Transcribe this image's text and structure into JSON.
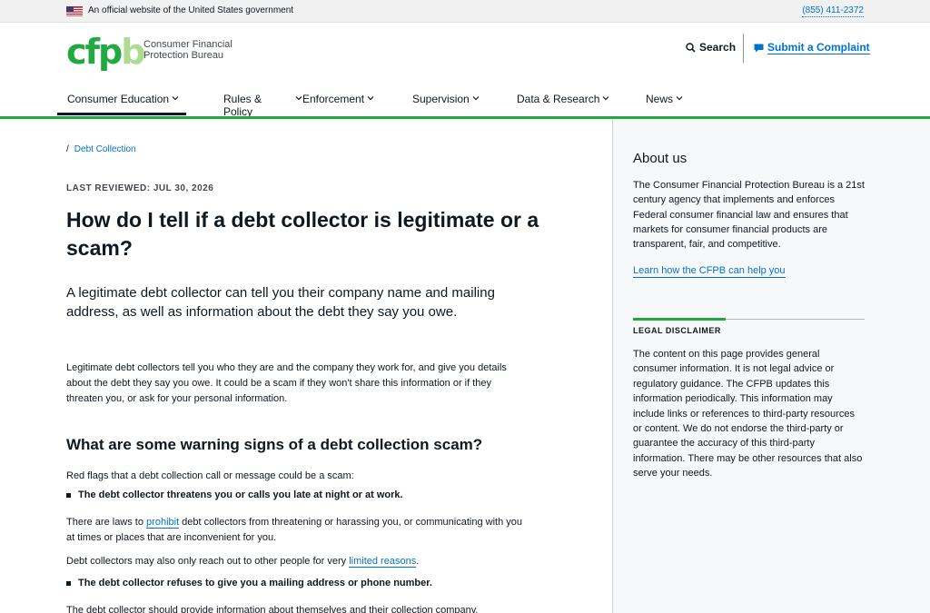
{
  "banner": {
    "text": "An official website of the United States government",
    "phone": "(855) 411-2372"
  },
  "header": {
    "logo_mark": "cfpb",
    "logo_line1": "Consumer Financial",
    "logo_line2": "Protection Bureau",
    "search_label": "Search",
    "complaint_label": "Submit a Complaint"
  },
  "nav": {
    "items": [
      {
        "label": "Consumer Education"
      },
      {
        "label": "Rules & Policy"
      },
      {
        "label": "Enforcement"
      },
      {
        "label": "Supervision"
      },
      {
        "label": "Data & Research"
      },
      {
        "label": "News"
      }
    ]
  },
  "breadcrumb": {
    "sep": "/",
    "item": "Debt Collection"
  },
  "article": {
    "reviewed": "LAST REVIEWED: JUL 30, 2026",
    "title": "How do I tell if a debt collector is legitimate or a scam?",
    "lead": "A legitimate debt collector can tell you their company name and mailing address, as well as information about the debt they say you owe.",
    "para1": "Legitimate debt collectors tell you who they are and the company they work for, and give you details about the debt they say you owe. It could be a scam if they won't share this information or if they threaten you, or ask for your personal information.",
    "h2": "What are some warning signs of a debt collection scam?",
    "red_flags": "Red flags that a debt collection call or message could be a scam:",
    "bullet1": "The debt collector threatens you or calls you late at night or at work.",
    "para2_pre": "There are laws to ",
    "para2_link": "prohibit",
    "para2_post": " debt collectors from threatening or harassing you, or communicating with you at times or places that are inconvenient for you.",
    "para3_pre": "Debt collectors may also only reach out to other people for very ",
    "para3_link": "limited reasons",
    "para3_post": ".",
    "bullet2": "The debt collector refuses to give you a mailing address or phone number.",
    "para4": "The debt collector should provide information about themselves and their collection company."
  },
  "sidebar": {
    "about_heading": "About us",
    "about_text": "The Consumer Financial Protection Bureau is a 21st century agency that implements and enforces Federal consumer financial law and ensures that markets for consumer financial products are transparent, fair, and competitive.",
    "about_link": "Learn how the CFPB can help you",
    "legal_heading": "LEGAL DISCLAIMER",
    "legal_text": "The content on this page provides general consumer information. It is not legal advice or regulatory guidance. The CFPB updates this information periodically. This information may include links or references to third-party resources or content. We do not endorse the third-party or guarantee the accuracy of this third-party information. There may be other resources that also serve your needs."
  },
  "colors": {
    "brand_green": "#20aa3f",
    "link_blue": "#0072ce",
    "text": "#101820"
  }
}
